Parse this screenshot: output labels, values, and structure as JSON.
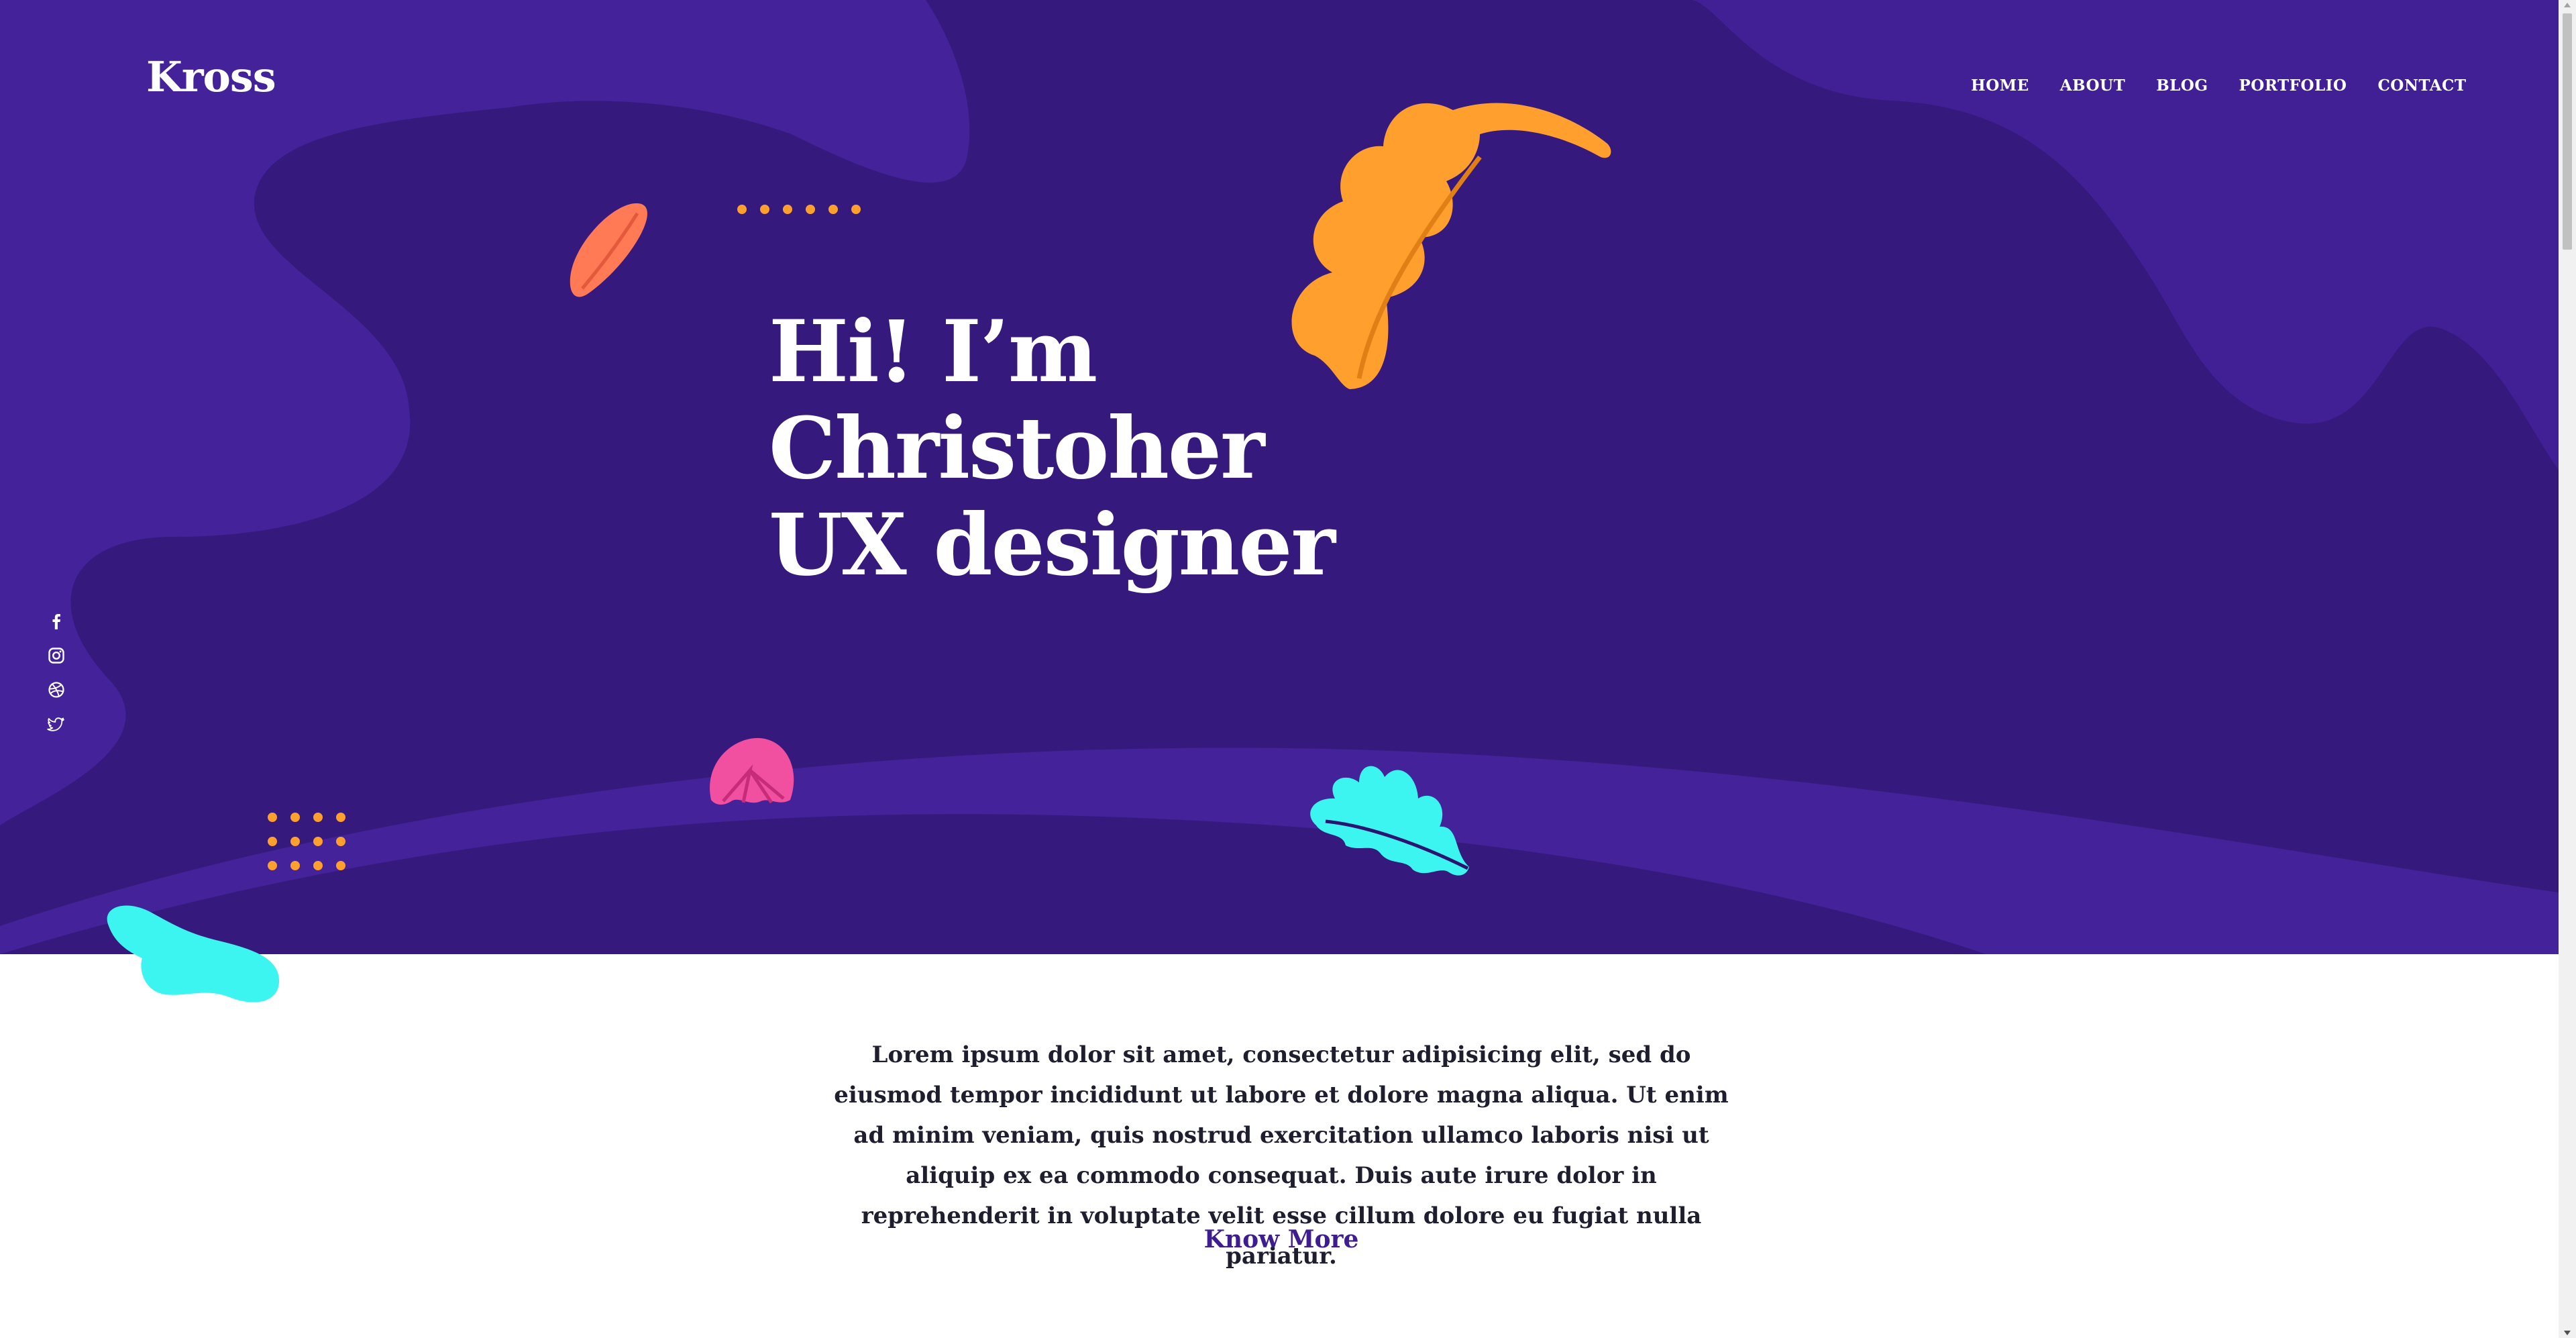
{
  "brand": {
    "logo": "Kross"
  },
  "nav": [
    "HOME",
    "ABOUT",
    "BLOG",
    "PORTFOLIO",
    "CONTACT"
  ],
  "hero": {
    "headline_lines": [
      "Hi! I’m",
      "Christoher",
      "UX designer"
    ]
  },
  "social_icons": [
    "facebook-icon",
    "instagram-icon",
    "dribbble-icon",
    "twitter-icon"
  ],
  "intro": {
    "text": "Lorem ipsum dolor sit amet, consectetur adipisicing elit, sed do eiusmod tempor incididunt ut labore et dolore magna aliqua. Ut enim ad minim veniam, quis nostrud exercitation ullamco laboris nisi ut aliquip ex ea commodo consequat. Duis aute irure dolor in reprehenderit in voluptate velit esse cillum dolore eu fugiat nulla pariatur.",
    "cta": "Know More"
  },
  "colors": {
    "hero_bg": "#36197c",
    "hero_blob": "#43229a",
    "orange": "#ff9f2e",
    "coral": "#ff7a55",
    "pink": "#f0509f",
    "cyan": "#3cf5f0",
    "link": "#3d1d8f"
  }
}
